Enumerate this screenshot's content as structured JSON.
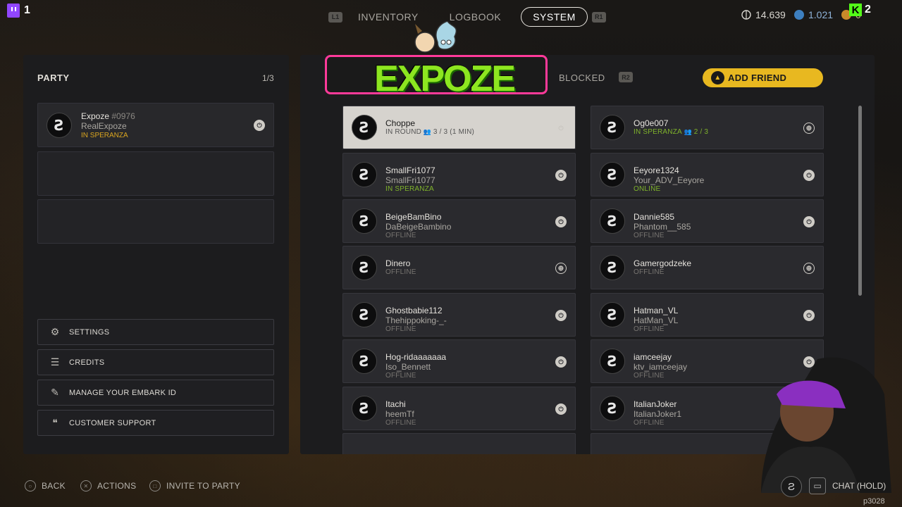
{
  "top": {
    "twitch_count": "1",
    "tabs": [
      {
        "shoulder": "L1"
      },
      {
        "label": "INVENTORY"
      },
      {
        "label": "LOGBOOK"
      },
      {
        "label": "SYSTEM",
        "active": true
      },
      {
        "shoulder": "R1"
      }
    ],
    "shoulder_left": "L1",
    "shoulder_right": "R1",
    "tab_inventory": "INVENTORY",
    "tab_logbook": "LOGBOOK",
    "tab_system": "SYSTEM",
    "currency1": "14.639",
    "currency2": "1.021",
    "currency3": "0",
    "kick_count": "2"
  },
  "party": {
    "title": "PARTY",
    "count": "1/3",
    "member": {
      "name": "Expoze",
      "tag": "#0976",
      "platform_name": "RealExpoze",
      "status": "IN SPERANZA"
    }
  },
  "menu": {
    "settings": "SETTINGS",
    "credits": "CREDITS",
    "embark": "MANAGE YOUR EMBARK ID",
    "support": "CUSTOMER SUPPORT"
  },
  "friends_header": {
    "blocked": "BLOCKED",
    "r2": "R2",
    "add_friend": "ADD FRIEND"
  },
  "overlay": {
    "word": "EXPOZE"
  },
  "friends_left": [
    {
      "name": "Choppe",
      "sub": "",
      "status": "IN ROUND",
      "extra": "3 / 3 (1 MIN)",
      "platform": "ps"
    },
    {
      "name": "SmallFri1077",
      "sub": "SmallFri1077",
      "status": "IN SPERANZA",
      "platform": "ps"
    },
    {
      "name": "BeigeBamBino",
      "sub": "DaBeigeBambino",
      "status": "OFFLINE",
      "platform": "ps"
    },
    {
      "name": "Dinero",
      "sub": "",
      "status": "OFFLINE",
      "platform": "globe"
    },
    {
      "name": "Ghostbabie112",
      "sub": "Thehippoking-_-",
      "status": "OFFLINE",
      "platform": "ps"
    },
    {
      "name": "Hog-ridaaaaaaa",
      "sub": "Iso_Bennett",
      "status": "OFFLINE",
      "platform": "ps"
    },
    {
      "name": "Itachi",
      "sub": "heemTf",
      "status": "OFFLINE",
      "platform": "ps"
    }
  ],
  "friends_right": [
    {
      "name": "Og0e007",
      "sub": "",
      "status": "IN SPERANZA",
      "extra": "2 / 3",
      "platform": "globe"
    },
    {
      "name": "Eeyore1324",
      "sub": "Your_ADV_Eeyore",
      "status": "ONLINE",
      "platform": "ps"
    },
    {
      "name": "Dannie585",
      "sub": "Phantom__585",
      "status": "OFFLINE",
      "platform": "ps"
    },
    {
      "name": "Gamergodzeke",
      "sub": "",
      "status": "OFFLINE",
      "platform": "globe"
    },
    {
      "name": "Hatman_VL",
      "sub": "HatMan_VL",
      "status": "OFFLINE",
      "platform": "ps"
    },
    {
      "name": "iamceejay",
      "sub": "ktv_iamceejay",
      "status": "OFFLINE",
      "platform": "ps"
    },
    {
      "name": "ItalianJoker",
      "sub": "ItalianJoker1",
      "status": "OFFLINE",
      "platform": "ps"
    }
  ],
  "bottom": {
    "back": "BACK",
    "actions": "ACTIONS",
    "invite": "INVITE TO PARTY",
    "chat": "CHAT (HOLD)",
    "code": "p3028"
  },
  "colors": {
    "accent_yellow": "#e8b820",
    "status_online": "#7fb32b",
    "status_insperanza": "#7fb32b",
    "status_party": "#d9a520",
    "offline": "#777470"
  }
}
